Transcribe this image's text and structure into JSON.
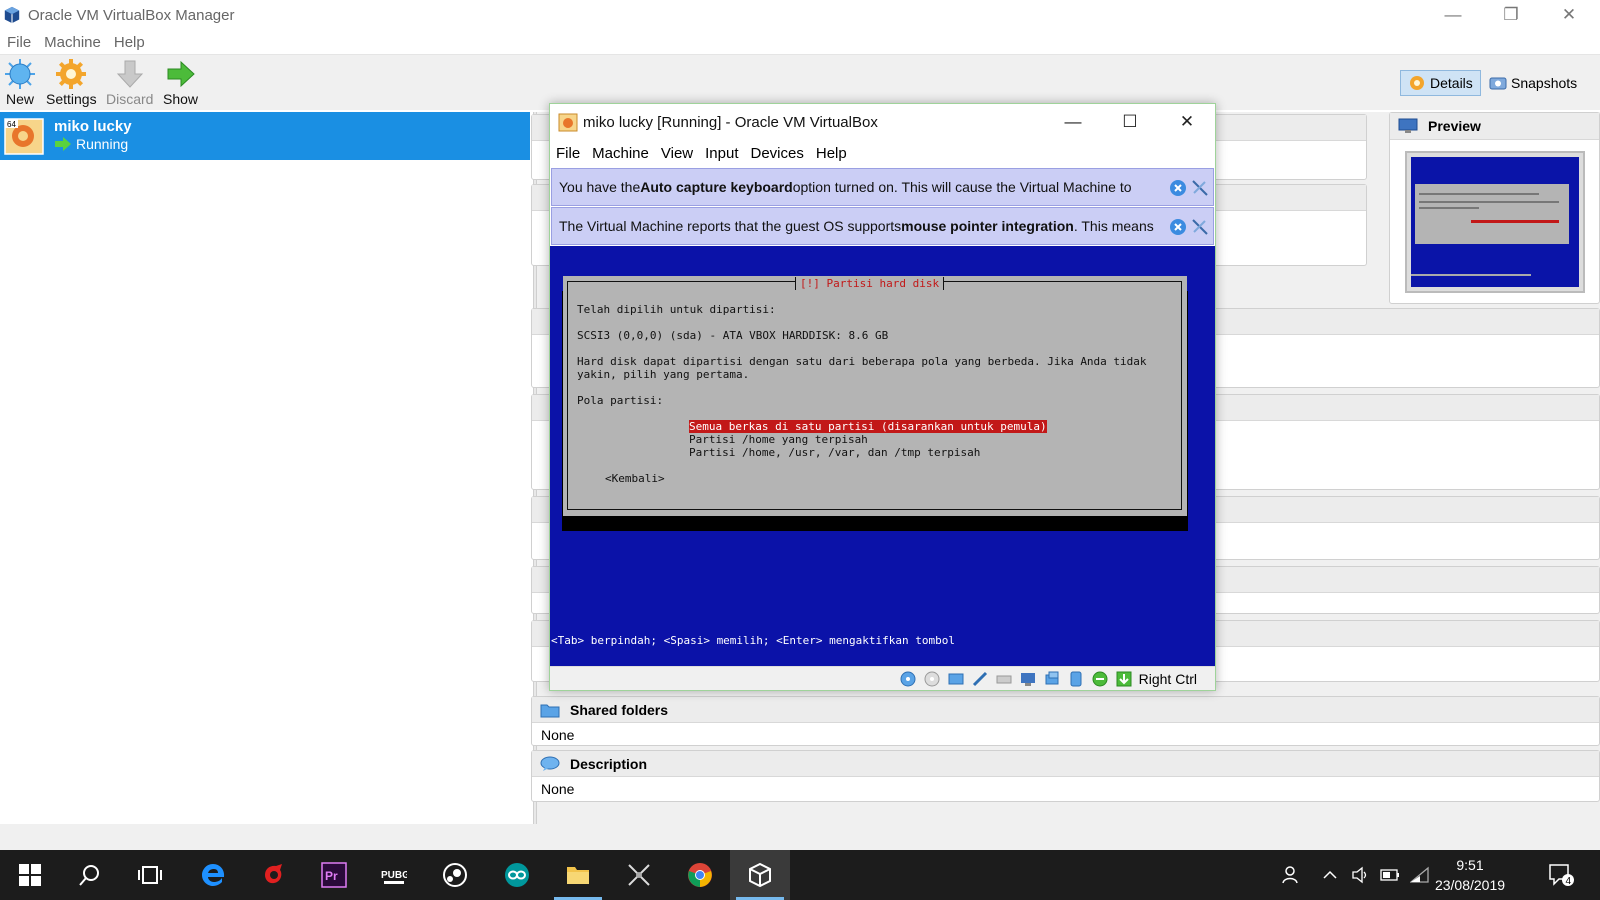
{
  "manager": {
    "title": "Oracle VM VirtualBox Manager",
    "menu": [
      "File",
      "Machine",
      "Help"
    ],
    "toolbar": {
      "new_label": "New",
      "settings_label": "Settings",
      "discard_label": "Discard",
      "show_label": "Show",
      "details_label": "Details",
      "snapshots_label": "Snapshots"
    },
    "vm_list": [
      {
        "name": "miko lucky",
        "state": "Running",
        "os_badge": "64"
      }
    ],
    "sections": {
      "preview": "Preview",
      "shared_folders": {
        "title": "Shared folders",
        "value": "None"
      },
      "description": {
        "title": "Description",
        "value": "None"
      }
    }
  },
  "vm_window": {
    "title": "miko lucky [Running] - Oracle VM VirtualBox",
    "menu": [
      "File",
      "Machine",
      "View",
      "Input",
      "Devices",
      "Help"
    ],
    "notice1": {
      "pre": "You have the ",
      "bold": "Auto capture keyboard",
      "post": " option turned on. This will cause the Virtual Machine to"
    },
    "notice2": {
      "pre": "The Virtual Machine reports that the guest OS supports ",
      "bold": "mouse pointer integration",
      "post": ". This means"
    },
    "screen": {
      "dialog_title": "[!] Partisi hard disk",
      "line1": "Telah dipilih untuk dipartisi:",
      "line2": "SCSI3 (0,0,0) (sda) - ATA VBOX HARDDISK: 8.6 GB",
      "line3": "Hard disk dapat dipartisi dengan satu dari beberapa pola yang berbeda. Jika Anda tidak",
      "line4": "yakin, pilih yang pertama.",
      "line5": "Pola partisi:",
      "options": [
        "Semua berkas di satu partisi (disarankan untuk pemula)",
        "Partisi /home yang terpisah",
        "Partisi /home, /usr, /var, dan /tmp terpisah"
      ],
      "back": "<Kembali>",
      "hint": "<Tab> berpindah; <Spasi> memilih; <Enter> mengaktifkan tombol"
    },
    "host_key": "Right Ctrl"
  },
  "taskbar": {
    "time": "9:51",
    "date": "23/08/2019",
    "notification_count": "4"
  },
  "colors": {
    "selection": "#1a8fe3",
    "vm_screen_bg": "#0b12a8",
    "dialog_bg": "#b4b4b4",
    "highlight_red": "#c21818",
    "notice_bg": "#cbcef5",
    "taskbar_bg": "#1c1c1c"
  }
}
